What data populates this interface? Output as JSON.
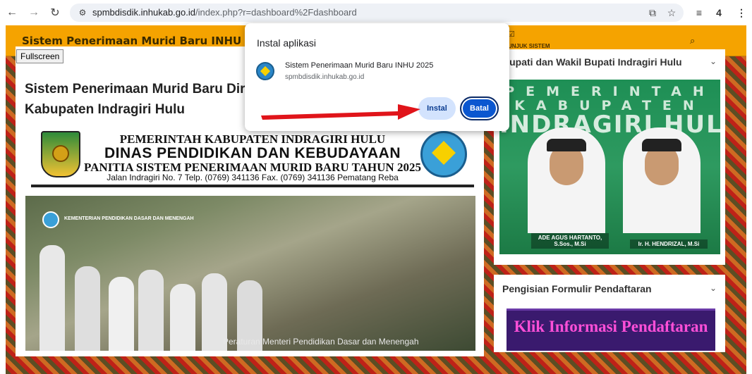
{
  "browser": {
    "url_host": "spmbdisdik.inhukab.go.id",
    "url_path": "/index.php?r=dashboard%2Fdashboard",
    "extensions_count": "4"
  },
  "site": {
    "title": "Sistem Penerimaan Murid Baru INHU 2025",
    "nav_item": "PETUNJUK SISTEM",
    "nav_item_visible": "UNJUK SISTEM"
  },
  "main": {
    "fullscreen_label": "Fullscreen",
    "heading": "Sistem Penerimaan Murid Baru Dinas Pendidikan dan Kebudayaan Kabupaten Indragiri Hulu",
    "heading_visible": "Sistem Penerimaan Murid Baru Dir",
    "heading_line2": "Kabupaten Indragiri Hulu",
    "letterhead": {
      "line1": "PEMERINTAH KABUPATEN INDRAGIRI HULU",
      "line2": "DINAS PENDIDIKAN DAN KEBUDAYAAN",
      "line3": "PANITIA SISTEM PENERIMAAN MURID BARU TAHUN 2025",
      "line4": "Jalan Indragiri No. 7 Telp. (0769) 341136 Fax. (0769) 341136 Pematang Reba"
    },
    "photo": {
      "ministry": "KEMENTERIAN PENDIDIKAN DASAR DAN MENENGAH",
      "caption": "Peraturan Menteri Pendidikan Dasar dan Menengah"
    }
  },
  "sidebar": {
    "card1_title": "Bupati dan Wakil Bupati Indragiri Hulu",
    "card1_title_visible": "Bupati dan Wakil Bupati Indragiri Hulu",
    "banner": {
      "line1": "PEMERINTAH",
      "line2": "KABUPATEN",
      "line3": "INDRAGIRI HULU",
      "person1": "ADE AGUS HARTANTO, S.Sos., M.Si",
      "person2": "Ir. H. HENDRIZAL, M.Si"
    },
    "card2_title": "Pengisian Formulir Pendaftaran",
    "klik_label": "Klik Informasi Pendaftaran"
  },
  "install_dialog": {
    "title": "Instal aplikasi",
    "app_name": "Sistem Penerimaan Murid Baru INHU 2025",
    "app_url": "spmbdisdik.inhukab.go.id",
    "install_label": "Instal",
    "cancel_label": "Batal"
  },
  "colors": {
    "header": "#f5a300",
    "accent": "#0b57d0",
    "arrow": "#e0141a"
  }
}
